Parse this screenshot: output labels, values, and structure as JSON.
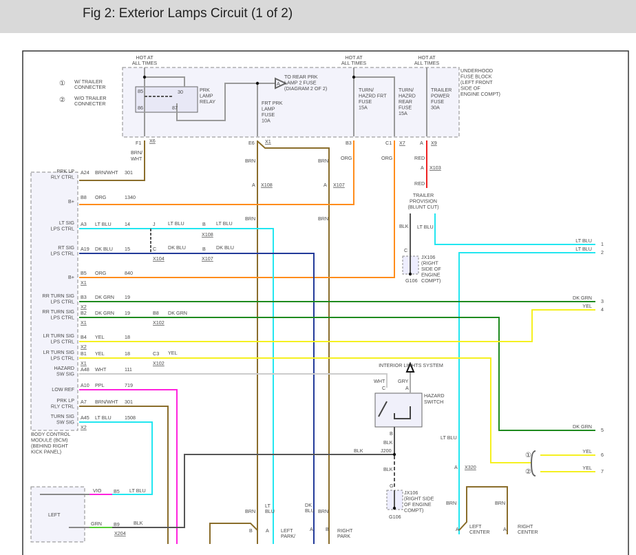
{
  "header": {
    "title": "Fig 2: Exterior Lamps Circuit (1 of 2)"
  },
  "colors": {
    "brn": "#8a6d2b",
    "org": "#ff8c1a",
    "red": "#ee2222",
    "ltblu": "#22e6f0",
    "dkblu": "#223a99",
    "dkgrn": "#1e8a1e",
    "yel": "#f5f020",
    "wht": "#cccccc",
    "ppl": "#ff22dd",
    "blk": "#555555",
    "grn": "#55cc33"
  },
  "legend": {
    "sym1": "①",
    "text1": [
      "W/ TRAILER",
      "CONNECTER"
    ],
    "sym2": "②",
    "text2": [
      "W/O TRAILER",
      "CONNECTER"
    ]
  },
  "hot": [
    "HOT AT",
    "ALL TIMES"
  ],
  "relay": {
    "p85": "85",
    "p30": "30",
    "p86": "86",
    "p87": "87",
    "label": [
      "PRK",
      "LAMP",
      "RELAY"
    ]
  },
  "to_rear": {
    "sym": "A",
    "label": [
      "TO REAR PRK",
      "LAMP 2 FUSE",
      "(DIAGRAM 2 OF 2)"
    ]
  },
  "fuses": {
    "frt_prk": [
      "FRT PRK",
      "LAMP",
      "FUSE",
      "10A"
    ],
    "turn_frt": [
      "TURN/",
      "HAZRD FRT",
      "FUSE",
      "15A"
    ],
    "turn_rear": [
      "TURN/",
      "HAZRD",
      "REAR",
      "FUSE",
      "15A"
    ],
    "trailer": [
      "TRAILER",
      "POWER",
      "FUSE",
      "30A"
    ]
  },
  "fuse_block": [
    "UNDERHOOD",
    "FUSE BLOCK",
    "(LEFT FRONT",
    "SIDE OF",
    "ENGINE COMPT)"
  ],
  "conn_top": {
    "f1": "F1",
    "x6": "X6",
    "e6": "E6",
    "x1": "X1",
    "b3": "B3",
    "c1": "C1",
    "x7": "X7",
    "a": "A",
    "x9": "X9",
    "x103": "X103",
    "x108": "X108",
    "x107": "X107"
  },
  "wires_top": {
    "brnwht": [
      "BRN/",
      "WHT"
    ],
    "brn": "BRN",
    "org": "ORG",
    "red": "RED"
  },
  "trailer_prov": [
    "TRAILER",
    "PROVISION",
    "(BLUNT CUT)"
  ],
  "ground1": {
    "c": "C",
    "blk": "BLK",
    "ltblu": "LT BLU",
    "label": [
      "JX106",
      "(RIGHT",
      "SIDE OF",
      "ENGINE",
      "COMPT)"
    ],
    "g": "G106"
  },
  "bcm": {
    "rows": [
      {
        "label": [
          "PRK LP",
          "RLY CTRL"
        ],
        "pin": "A24",
        "conn": "",
        "color": "BRN/WHT",
        "circuit": "301"
      },
      {
        "label": [
          "B+"
        ],
        "pin": "B8",
        "conn": "",
        "color": "ORG",
        "circuit": "1340"
      },
      {
        "label": [
          "LT SIG",
          "LPS CTRL"
        ],
        "pin": "A3",
        "conn": "",
        "color": "LT BLU",
        "circuit": "14"
      },
      {
        "label": [
          "RT SIG",
          "LPS CTRL"
        ],
        "pin": "A19",
        "conn": "",
        "color": "DK BLU",
        "circuit": "15"
      },
      {
        "label": [
          "B+"
        ],
        "pin": "B5",
        "conn": "X1",
        "color": "ORG",
        "circuit": "840"
      },
      {
        "label": [
          "RR TURN SIG",
          "LPS CTRL"
        ],
        "pin": "B3",
        "conn": "X2",
        "color": "DK GRN",
        "circuit": "19"
      },
      {
        "label": [
          "RR TURN SIG",
          "LPS CTRL"
        ],
        "pin": "B2",
        "conn": "X1",
        "color": "DK GRN",
        "circuit": "19"
      },
      {
        "label": [
          "LR TURN SIG",
          "LPS CTRL"
        ],
        "pin": "B4",
        "conn": "X2",
        "color": "YEL",
        "circuit": "18"
      },
      {
        "label": [
          "LR TURN SIG",
          "LPS CTRL"
        ],
        "pin": "B1",
        "conn": "X1",
        "color": "YEL",
        "circuit": "18"
      },
      {
        "label": [
          "HAZARD",
          "SW SIG"
        ],
        "pin": "A48",
        "conn": "",
        "color": "WHT",
        "circuit": "111"
      },
      {
        "label": [
          "LOW REF"
        ],
        "pin": "A10",
        "conn": "",
        "color": "PPL",
        "circuit": "719"
      },
      {
        "label": [
          "PRK LP",
          "RLY CTRL"
        ],
        "pin": "A7",
        "conn": "",
        "color": "BRN/WHT",
        "circuit": "301"
      },
      {
        "label": [
          "TURN SIG",
          "SW SIG"
        ],
        "pin": "A45",
        "conn": "X2",
        "color": "LT BLU",
        "circuit": "1508"
      }
    ],
    "name": [
      "BODY CONTROL",
      "MODULE (BCM)",
      "(BEHIND RIGHT",
      "KICK PANEL)"
    ]
  },
  "inline": {
    "j": "J",
    "b": "B",
    "c": "C",
    "b8": "B8",
    "c3": "C3",
    "ltblu": "LT BLU",
    "dkblu": "DK BLU",
    "dkgrn": "DK GRN",
    "yel": "YEL",
    "x108": "X108",
    "x104": "X104",
    "x107": "X107",
    "x102": "X102"
  },
  "right_ends": [
    {
      "color": "LT BLU",
      "num": "1"
    },
    {
      "color": "LT BLU",
      "num": "2"
    },
    {
      "color": "DK GRN",
      "num": "3"
    },
    {
      "color": "YEL",
      "num": "4"
    },
    {
      "color": "DK GRN",
      "num": "5"
    },
    {
      "color": "YEL",
      "num": "6"
    },
    {
      "color": "YEL",
      "num": "7"
    }
  ],
  "hazard": {
    "system": "INTERIOR LIGHTS SYSTEM",
    "wht": "WHT",
    "gry": "GRY",
    "c": "C",
    "a": "A",
    "label": [
      "HAZARD",
      "SWITCH"
    ],
    "b": "B",
    "blk": "BLK",
    "j200": "J200",
    "g": "G",
    "ground_label": [
      "JX106",
      "(RIGHT SIDE",
      "OF ENGINE",
      "COMPT)"
    ],
    "ground": "G106"
  },
  "lower": {
    "ltblu": "LT BLU",
    "a": "A",
    "x320": "X320",
    "brn": "BRN",
    "left_center": [
      "LEFT",
      "CENTER"
    ],
    "right_center": [
      "RIGHT",
      "CENTER"
    ],
    "ltblu2": [
      "LT",
      "BLU"
    ],
    "dkblu2": [
      "DK",
      "BLU"
    ],
    "b": "B",
    "left_park": [
      "LEFT",
      "PARK/"
    ],
    "right_park": [
      "RIGHT",
      "PARK"
    ]
  },
  "switch_box": {
    "vio": "VIO",
    "b5": "B5",
    "ltblu": "LT BLU",
    "left": "LEFT",
    "grn": "GRN",
    "b9": "B9",
    "blk": "BLK",
    "x204": "X204"
  }
}
